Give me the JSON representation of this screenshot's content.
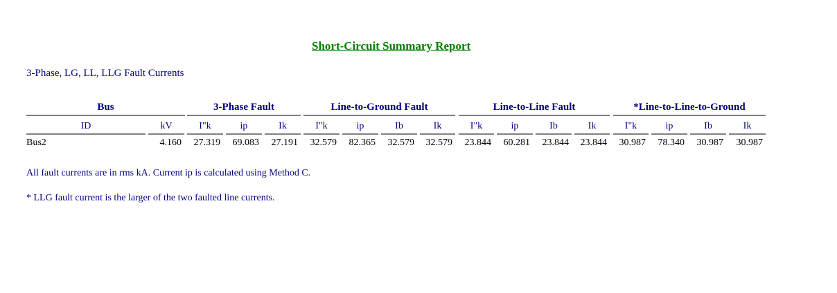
{
  "report": {
    "title": "Short-Circuit Summary Report",
    "subtitle": "3-Phase, LG, LL,  LLG Fault Currents",
    "note_units": "All fault currents are in rms kA.  Current ip is calculated using Method C.",
    "note_llg": "* LLG fault current is the larger of the two faulted line currents."
  },
  "groups": {
    "bus": "Bus",
    "three_phase": "3-Phase Fault",
    "line_to_ground": "Line-to-Ground Fault",
    "line_to_line": "Line-to-Line Fault",
    "llg": "*Line-to-Line-to-Ground"
  },
  "columns": [
    "ID",
    "kV",
    "I\"k",
    "ip",
    "Ik",
    "I\"k",
    "ip",
    "Ib",
    "Ik",
    "I\"k",
    "ip",
    "Ib",
    "Ik",
    "I\"k",
    "ip",
    "Ib",
    "Ik"
  ],
  "rows": [
    [
      "Bus2",
      "4.160",
      "27.319",
      "69.083",
      "27.191",
      "32.579",
      "82.365",
      "32.579",
      "32.579",
      "23.844",
      "60.281",
      "23.844",
      "23.844",
      "30.987",
      "78.340",
      "30.987",
      "30.987"
    ]
  ]
}
